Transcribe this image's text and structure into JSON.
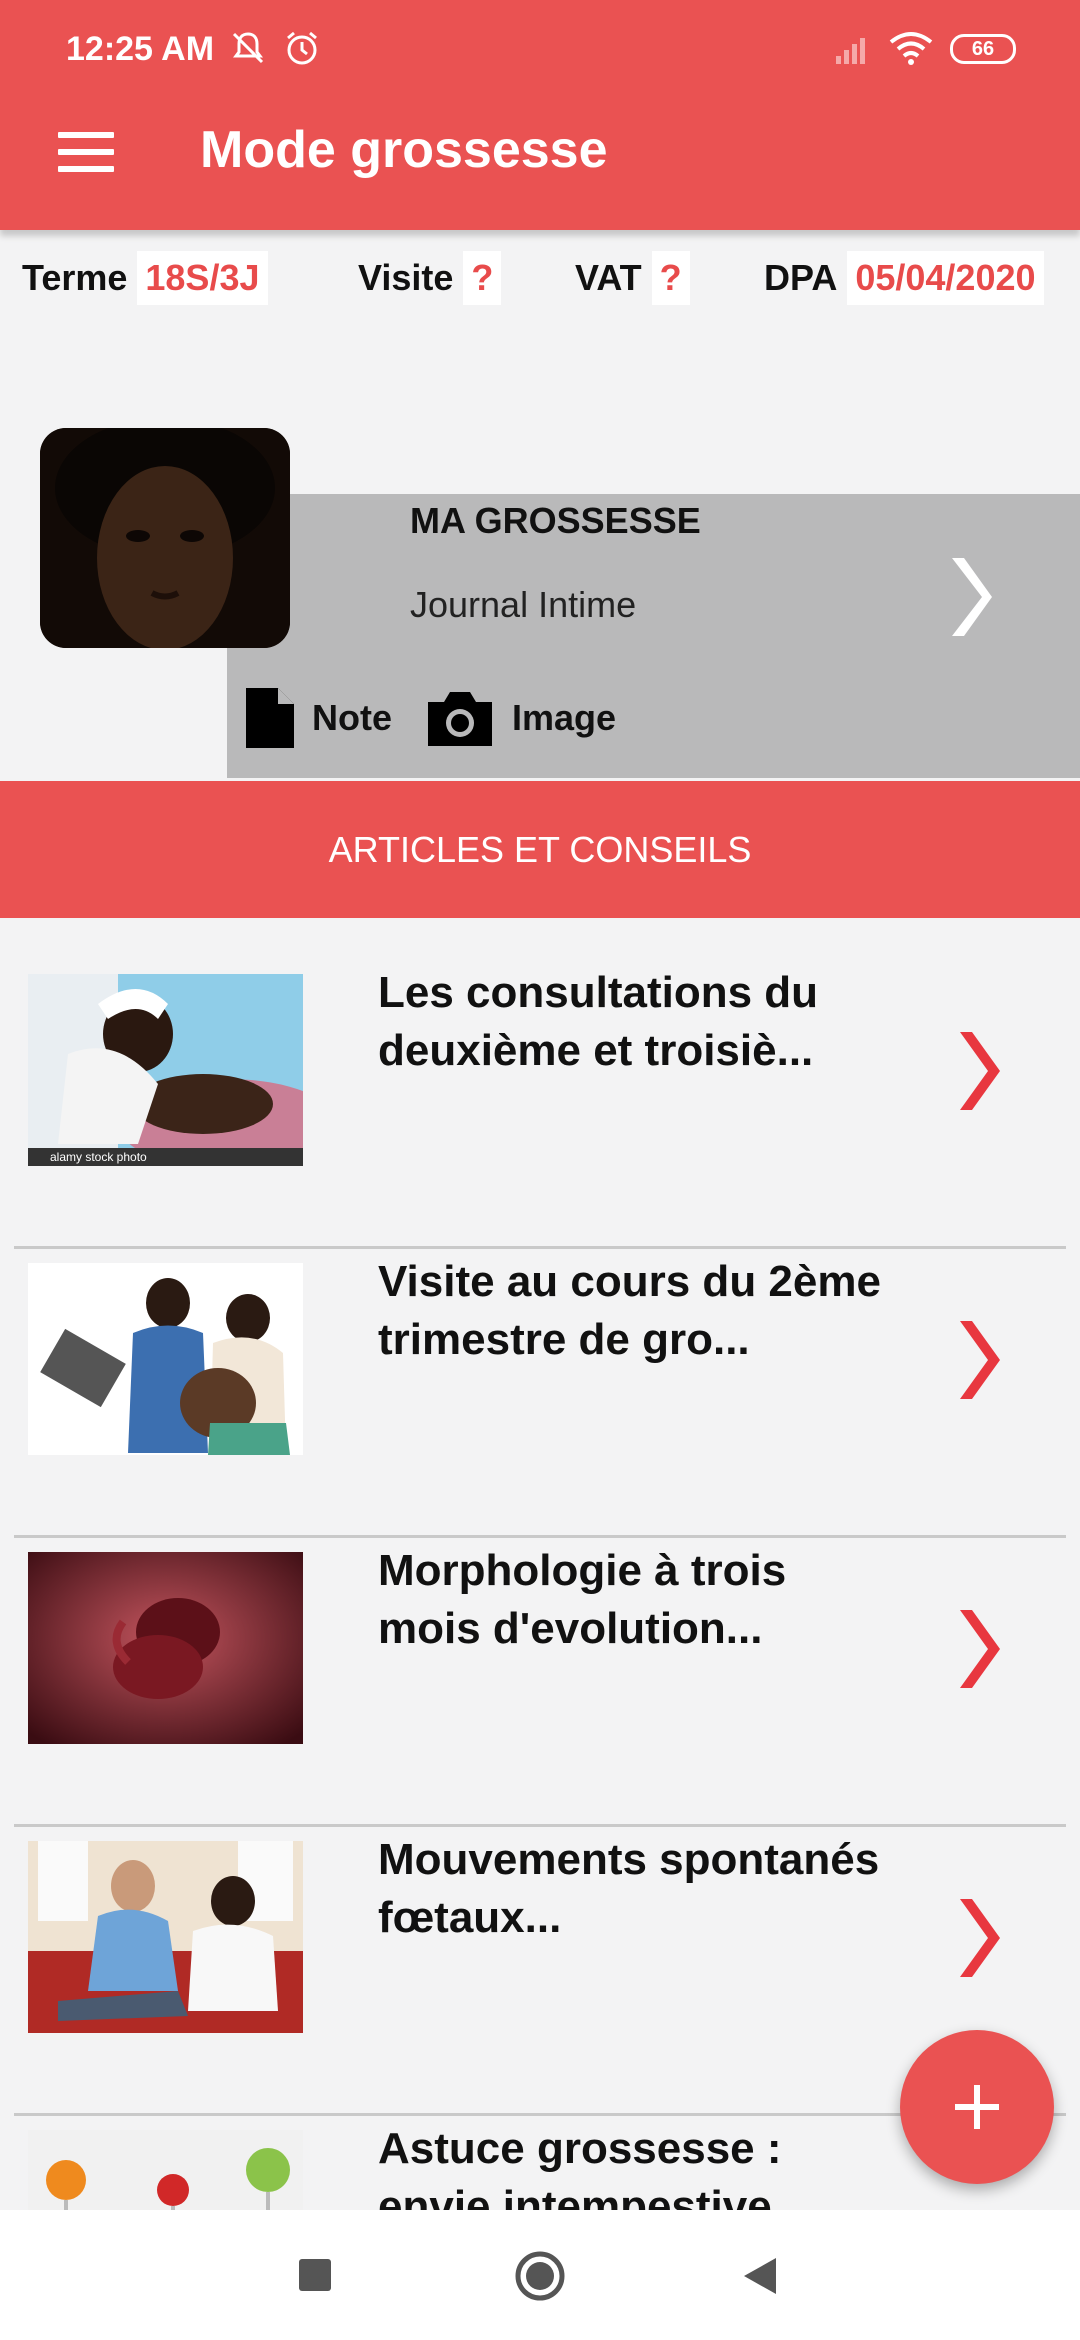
{
  "status_bar": {
    "time": "12:25 AM",
    "battery": "66"
  },
  "app_bar": {
    "title": "Mode grossesse"
  },
  "info": [
    {
      "label": "Terme",
      "value": "18S/3J"
    },
    {
      "label": "Visite",
      "value": "?"
    },
    {
      "label": "VAT",
      "value": "?"
    },
    {
      "label": "DPA",
      "value": "05/04/2020"
    }
  ],
  "pregnancy_card": {
    "title": "MA GROSSESSE",
    "subtitle": "Journal Intime",
    "actions": [
      {
        "label": "Note",
        "icon": "document-icon"
      },
      {
        "label": "Image",
        "icon": "camera-icon"
      }
    ]
  },
  "section": {
    "title": "ARTICLES ET CONSEILS"
  },
  "articles": [
    {
      "title": "Les consultations du deuxième et troisiè...",
      "thumb": "caregiver-photo",
      "thumb_caption": "alamy stock photo"
    },
    {
      "title": "Visite au cours du 2ème trimestre de gro...",
      "thumb": "doctor-patient-photo"
    },
    {
      "title": "Morphologie à trois mois d'evolution...",
      "thumb": "fetus-photo"
    },
    {
      "title": "Mouvements spontanés fœtaux...",
      "thumb": "couple-photo"
    },
    {
      "title": "Astuce grossesse : envie intempestive",
      "thumb": "vegetables-photo"
    }
  ],
  "colors": {
    "accent": "#ea5252",
    "background": "#f3f3f4",
    "card": "#b9b9ba"
  }
}
